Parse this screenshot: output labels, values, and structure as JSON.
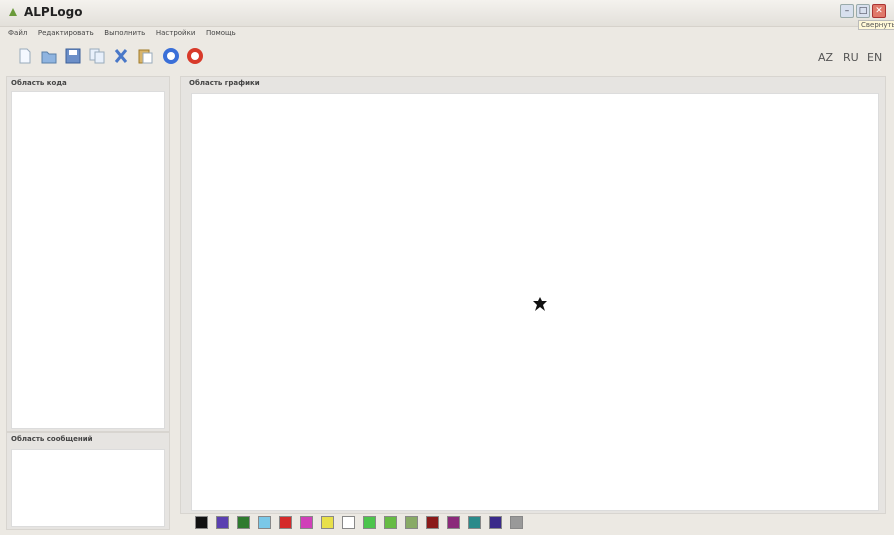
{
  "window": {
    "title": "ALPLogo",
    "tooltip": "Свернуть"
  },
  "menu": [
    "Файл",
    "Редактировать",
    "Выполнить",
    "Настройки",
    "Помощь"
  ],
  "toolbar": {
    "icons": [
      "new-file-icon",
      "open-folder-icon",
      "save-icon",
      "copy-icon",
      "cut-icon",
      "paste-icon",
      "run-icon",
      "stop-icon"
    ]
  },
  "languages": [
    "AZ",
    "RU",
    "EN"
  ],
  "panels": {
    "code_title": "Область кода",
    "graphics_title": "Область графики",
    "messages_title": "Область сообщений"
  },
  "palette": {
    "colors": [
      "#111111",
      "#5a3fb0",
      "#2f7a2f",
      "#7ac8e8",
      "#d42a2a",
      "#d040b8",
      "#e8e04a",
      "#ffffff",
      "#4cc44c",
      "#66bb44",
      "#88aa66",
      "#8a1a1a",
      "#8a2a7a",
      "#2a8a8a",
      "#3a2a8a",
      "#999999"
    ]
  },
  "colors": {
    "window_bg": "#ece9e3",
    "canvas_bg": "#ffffff",
    "run_button": "#3a6fd8",
    "stop_button": "#d83a2a"
  }
}
